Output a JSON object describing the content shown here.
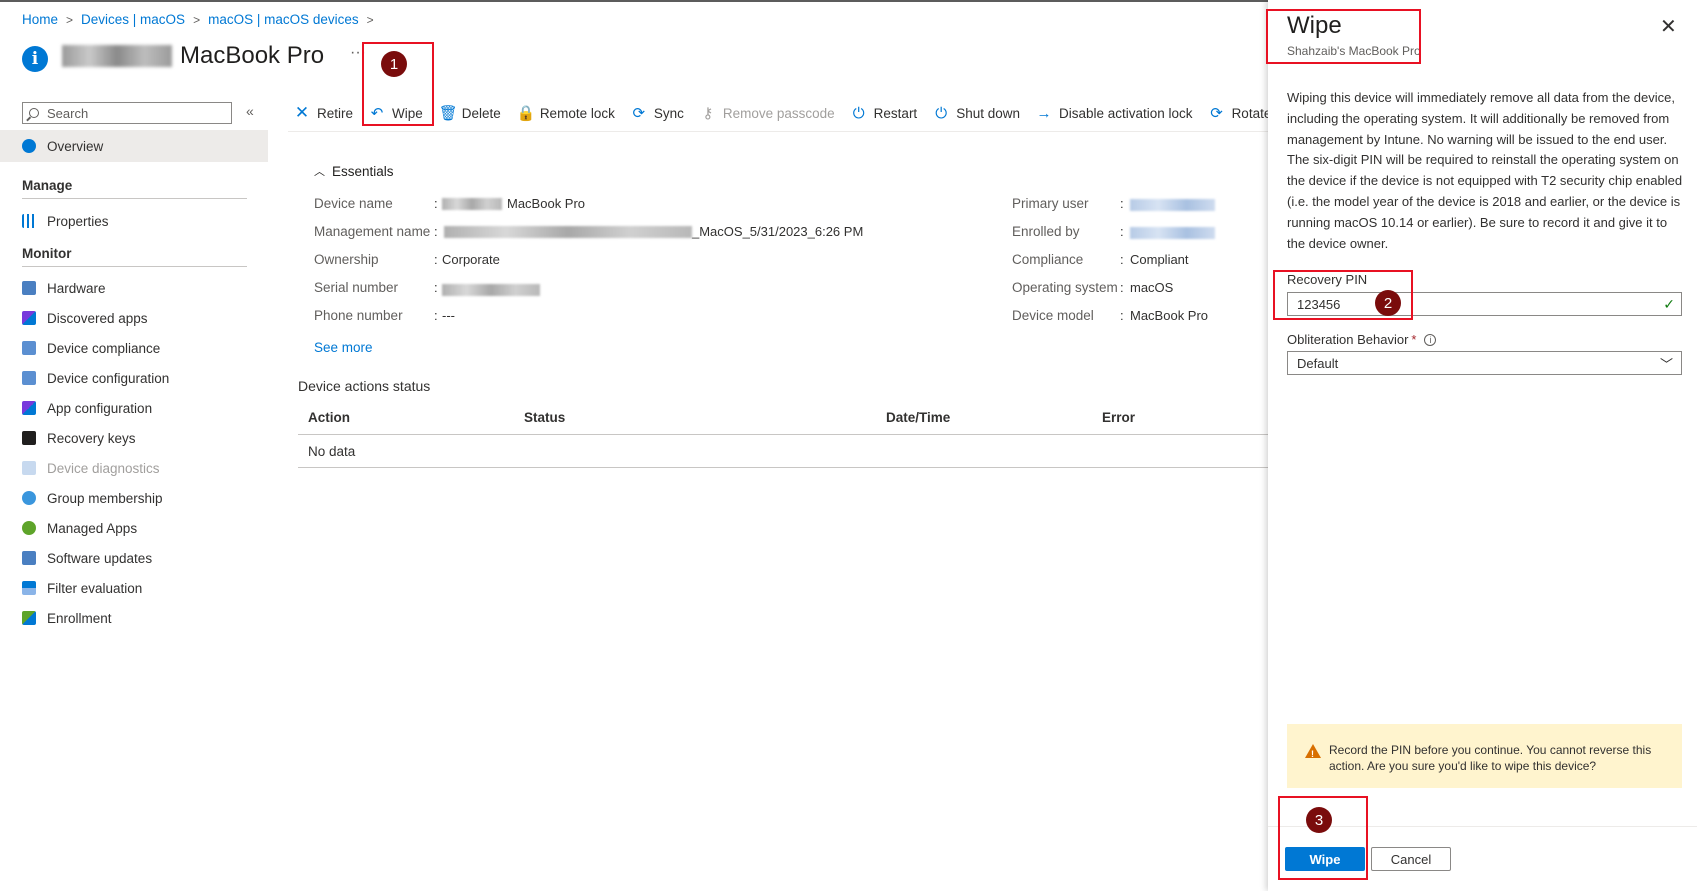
{
  "breadcrumb": [
    "Home",
    "Devices | macOS",
    "macOS | macOS devices"
  ],
  "page": {
    "title": "MacBook Pro",
    "more": "···"
  },
  "sidebar": {
    "search_placeholder": "Search",
    "collapse": "«",
    "overview": "Overview",
    "manage_header": "Manage",
    "manage_items": [
      "Properties"
    ],
    "monitor_header": "Monitor",
    "monitor_items": [
      "Hardware",
      "Discovered apps",
      "Device compliance",
      "Device configuration",
      "App configuration",
      "Recovery keys",
      "Device diagnostics",
      "Group membership",
      "Managed Apps",
      "Software updates",
      "Filter evaluation",
      "Enrollment"
    ]
  },
  "toolbar": {
    "retire": "Retire",
    "wipe": "Wipe",
    "delete": "Delete",
    "remote_lock": "Remote lock",
    "sync": "Sync",
    "remove_passcode": "Remove passcode",
    "restart": "Restart",
    "shut_down": "Shut down",
    "disable_activation_lock": "Disable activation lock",
    "rotate": "Rotate Fil"
  },
  "essentials": {
    "header": "Essentials",
    "left": [
      {
        "label": "Device name",
        "value": "MacBook Pro"
      },
      {
        "label": "Management name",
        "value": "_MacOS_5/31/2023_6:26 PM"
      },
      {
        "label": "Ownership",
        "value": "Corporate"
      },
      {
        "label": "Serial number",
        "value": ""
      },
      {
        "label": "Phone number",
        "value": "---"
      }
    ],
    "right": [
      {
        "label": "Primary user",
        "value": ""
      },
      {
        "label": "Enrolled by",
        "value": ""
      },
      {
        "label": "Compliance",
        "value": "Compliant"
      },
      {
        "label": "Operating system",
        "value": "macOS"
      },
      {
        "label": "Device model",
        "value": "MacBook Pro"
      }
    ],
    "see_more": "See more"
  },
  "device_actions": {
    "title": "Device actions status",
    "columns": [
      "Action",
      "Status",
      "Date/Time",
      "Error"
    ],
    "empty": "No data"
  },
  "panel": {
    "title": "Wipe",
    "subtitle": "Shahzaib's MacBook Pro",
    "close": "✕",
    "description": "Wiping this device will immediately remove all data from the device, including the operating system. It will additionally be removed from management by Intune. No warning will be issued to the end user. The six-digit PIN will be required to reinstall the operating system on the device if the device is not equipped with T2 security chip enabled (i.e. the model year of the device is 2018 and earlier, or the device is running macOS 10.14 or earlier). Be sure to record it and give it to the device owner.",
    "pin_label": "Recovery PIN",
    "pin_value": "123456",
    "obliteration_label": "Obliteration Behavior",
    "obliteration_required": "*",
    "obliteration_value": "Default",
    "warning": "Record the PIN before you continue. You cannot reverse this action. Are you sure you'd like to wipe this device?",
    "wipe_button": "Wipe",
    "cancel_button": "Cancel"
  },
  "callouts": [
    "1",
    "2",
    "3"
  ],
  "colors": {
    "accent": "#0078d4",
    "callout_border": "#e81123",
    "callout_badge": "#7a0c0c",
    "warning_bg": "#fff4ce"
  }
}
